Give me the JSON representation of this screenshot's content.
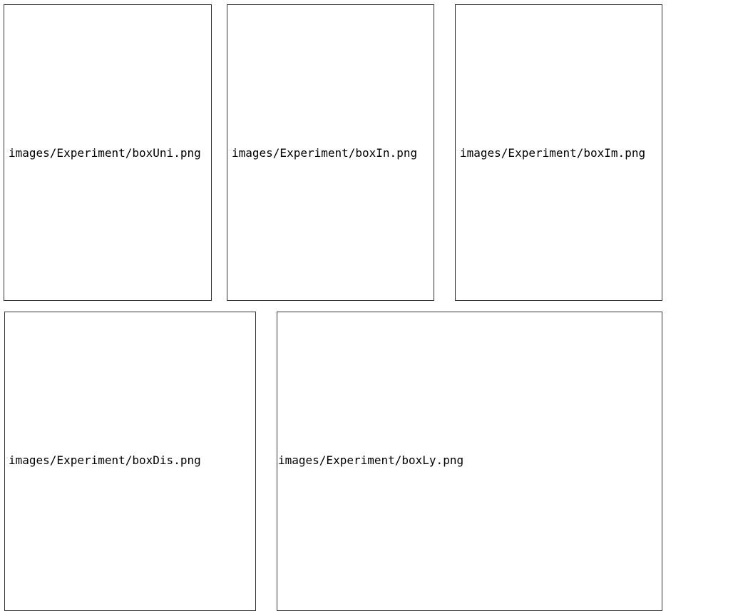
{
  "figures": {
    "row1": [
      {
        "id": "uni",
        "label": "images/Experiment/boxUni.png"
      },
      {
        "id": "in",
        "label": "images/Experiment/boxIn.png"
      },
      {
        "id": "im",
        "label": "images/Experiment/boxIm.png"
      }
    ],
    "row2": [
      {
        "id": "dis",
        "label": "images/Experiment/boxDis.png"
      },
      {
        "id": "ly",
        "label": "images/Experiment/boxLy.png"
      }
    ]
  },
  "colors": {
    "border": "#333333",
    "text": "#000000",
    "background": "#ffffff"
  }
}
